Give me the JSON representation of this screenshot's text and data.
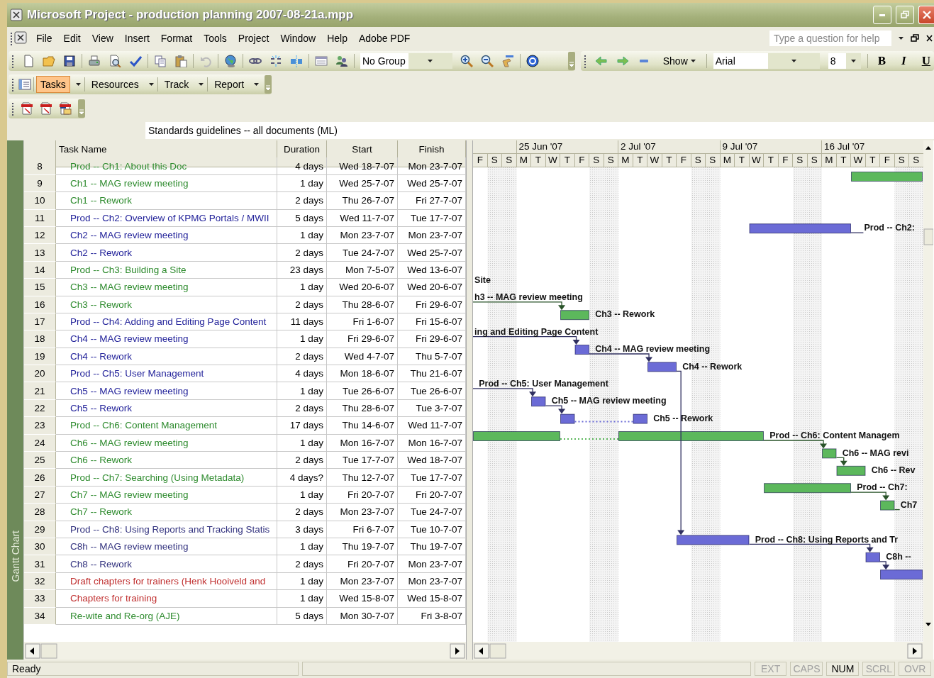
{
  "window": {
    "title": "Microsoft Project - production planning 2007-08-21a.mpp"
  },
  "menu": [
    "File",
    "Edit",
    "View",
    "Insert",
    "Format",
    "Tools",
    "Project",
    "Window",
    "Help",
    "Adobe PDF"
  ],
  "help_box": {
    "placeholder": "Type a question for help"
  },
  "standard_toolbar": {
    "group_combo": "No Group"
  },
  "formatting_toolbar": {
    "show_button": "Show",
    "font_combo": "Arial",
    "size_combo": "8",
    "style_buttons": [
      {
        "label": "B",
        "kind": "bold"
      },
      {
        "label": "I",
        "kind": "italic"
      },
      {
        "label": "U",
        "kind": "underline"
      }
    ]
  },
  "guide_toolbar": {
    "items": [
      {
        "label": "Tasks",
        "selected": true
      },
      {
        "label": "Resources",
        "selected": false
      },
      {
        "label": "Track",
        "selected": false
      },
      {
        "label": "Report",
        "selected": false
      }
    ]
  },
  "entry_bar": {
    "value": "Standards guidelines -- all documents (ML)"
  },
  "view_bar": {
    "label": "Gantt Chart"
  },
  "table": {
    "columns": [
      "Task Name",
      "Duration",
      "Start",
      "Finish"
    ],
    "rows": [
      {
        "id": "8",
        "name": "Prod -- Ch1: About this Doc",
        "duration": "4 days",
        "start": "Wed 18-7-07",
        "finish": "Mon 23-7-07",
        "color": "#2e8b2e"
      },
      {
        "id": "9",
        "name": "Ch1 -- MAG review meeting",
        "duration": "1 day",
        "start": "Wed 25-7-07",
        "finish": "Wed 25-7-07",
        "color": "#2e8b2e"
      },
      {
        "id": "10",
        "name": "Ch1 -- Rework",
        "duration": "2 days",
        "start": "Thu 26-7-07",
        "finish": "Fri 27-7-07",
        "color": "#2e8b2e"
      },
      {
        "id": "11",
        "name": "Prod -- Ch2: Overview of KPMG Portals / MWII",
        "duration": "5 days",
        "start": "Wed 11-7-07",
        "finish": "Tue 17-7-07",
        "color": "#22229a"
      },
      {
        "id": "12",
        "name": "Ch2 -- MAG review meeting",
        "duration": "1 day",
        "start": "Mon 23-7-07",
        "finish": "Mon 23-7-07",
        "color": "#22229a"
      },
      {
        "id": "13",
        "name": "Ch2 -- Rework",
        "duration": "2 days",
        "start": "Tue 24-7-07",
        "finish": "Wed 25-7-07",
        "color": "#22229a"
      },
      {
        "id": "14",
        "name": "Prod -- Ch3: Building a Site",
        "duration": "23 days",
        "start": "Mon 7-5-07",
        "finish": "Wed 13-6-07",
        "color": "#2e8b2e"
      },
      {
        "id": "15",
        "name": "Ch3 -- MAG review meeting",
        "duration": "1 day",
        "start": "Wed 20-6-07",
        "finish": "Wed 20-6-07",
        "color": "#2e8b2e"
      },
      {
        "id": "16",
        "name": "Ch3 -- Rework",
        "duration": "2 days",
        "start": "Thu 28-6-07",
        "finish": "Fri 29-6-07",
        "color": "#2e8b2e"
      },
      {
        "id": "17",
        "name": "Prod -- Ch4: Adding and Editing Page Content",
        "duration": "11 days",
        "start": "Fri 1-6-07",
        "finish": "Fri 15-6-07",
        "color": "#22229a"
      },
      {
        "id": "18",
        "name": "Ch4 -- MAG review meeting",
        "duration": "1 day",
        "start": "Fri 29-6-07",
        "finish": "Fri 29-6-07",
        "color": "#22229a"
      },
      {
        "id": "19",
        "name": "Ch4 -- Rework",
        "duration": "2 days",
        "start": "Wed 4-7-07",
        "finish": "Thu 5-7-07",
        "color": "#22229a"
      },
      {
        "id": "20",
        "name": "Prod -- Ch5: User Management",
        "duration": "4 days",
        "start": "Mon 18-6-07",
        "finish": "Thu 21-6-07",
        "color": "#22229a"
      },
      {
        "id": "21",
        "name": "Ch5 -- MAG review meeting",
        "duration": "1 day",
        "start": "Tue 26-6-07",
        "finish": "Tue 26-6-07",
        "color": "#22229a"
      },
      {
        "id": "22",
        "name": "Ch5 -- Rework",
        "duration": "2 days",
        "start": "Thu 28-6-07",
        "finish": "Tue 3-7-07",
        "color": "#22229a"
      },
      {
        "id": "23",
        "name": "Prod -- Ch6: Content Management",
        "duration": "17 days",
        "start": "Thu 14-6-07",
        "finish": "Wed 11-7-07",
        "color": "#2e8b2e"
      },
      {
        "id": "24",
        "name": "Ch6 -- MAG review meeting",
        "duration": "1 day",
        "start": "Mon 16-7-07",
        "finish": "Mon 16-7-07",
        "color": "#2e8b2e"
      },
      {
        "id": "25",
        "name": "Ch6 -- Rework",
        "duration": "2 days",
        "start": "Tue 17-7-07",
        "finish": "Wed 18-7-07",
        "color": "#2e8b2e"
      },
      {
        "id": "26",
        "name": "Prod -- Ch7: Searching (Using Metadata)",
        "duration": "4 days?",
        "start": "Thu 12-7-07",
        "finish": "Tue 17-7-07",
        "color": "#2e8b2e"
      },
      {
        "id": "27",
        "name": "Ch7 -- MAG review meeting",
        "duration": "1 day",
        "start": "Fri 20-7-07",
        "finish": "Fri 20-7-07",
        "color": "#2e8b2e"
      },
      {
        "id": "28",
        "name": "Ch7 -- Rework",
        "duration": "2 days",
        "start": "Mon 23-7-07",
        "finish": "Tue 24-7-07",
        "color": "#2e8b2e"
      },
      {
        "id": "29",
        "name": "Prod -- Ch8: Using Reports and Tracking Statis",
        "duration": "3 days",
        "start": "Fri 6-7-07",
        "finish": "Tue 10-7-07",
        "color": "#33337f"
      },
      {
        "id": "30",
        "name": "C8h -- MAG review meeting",
        "duration": "1 day",
        "start": "Thu 19-7-07",
        "finish": "Thu 19-7-07",
        "color": "#33337f"
      },
      {
        "id": "31",
        "name": "Ch8 -- Rework",
        "duration": "2 days",
        "start": "Fri 20-7-07",
        "finish": "Mon 23-7-07",
        "color": "#33337f"
      },
      {
        "id": "32",
        "name": "Draft chapters for trainers (Henk Hooiveld and",
        "duration": "1 day",
        "start": "Mon 23-7-07",
        "finish": "Mon 23-7-07",
        "color": "#c03030"
      },
      {
        "id": "33",
        "name": "Chapters for training",
        "duration": "1 day",
        "start": "Wed 15-8-07",
        "finish": "Wed 15-8-07",
        "color": "#c03030"
      },
      {
        "id": "34",
        "name": "Re-wite and Re-org (AJE)",
        "duration": "5 days",
        "start": "Mon 30-7-07",
        "finish": "Fri 3-8-07",
        "color": "#2e8b2e"
      }
    ]
  },
  "gantt": {
    "weeks": [
      "25 Jun '07",
      "2 Jul '07",
      "9 Jul '07",
      "16 Jul '07"
    ],
    "days": [
      {
        "label": "F",
        "weekend": false
      },
      {
        "label": "S",
        "weekend": true
      },
      {
        "label": "S",
        "weekend": true
      },
      {
        "label": "M",
        "weekend": false
      },
      {
        "label": "T",
        "weekend": false
      },
      {
        "label": "W",
        "weekend": false
      },
      {
        "label": "T",
        "weekend": false
      },
      {
        "label": "F",
        "weekend": false
      },
      {
        "label": "S",
        "weekend": true
      },
      {
        "label": "S",
        "weekend": true
      },
      {
        "label": "M",
        "weekend": false
      },
      {
        "label": "T",
        "weekend": false
      },
      {
        "label": "W",
        "weekend": false
      },
      {
        "label": "T",
        "weekend": false
      },
      {
        "label": "F",
        "weekend": false
      },
      {
        "label": "S",
        "weekend": true
      },
      {
        "label": "S",
        "weekend": true
      },
      {
        "label": "M",
        "weekend": false
      },
      {
        "label": "T",
        "weekend": false
      },
      {
        "label": "W",
        "weekend": false
      },
      {
        "label": "T",
        "weekend": false
      },
      {
        "label": "F",
        "weekend": false
      },
      {
        "label": "S",
        "weekend": true
      },
      {
        "label": "S",
        "weekend": true
      },
      {
        "label": "M",
        "weekend": false
      },
      {
        "label": "T",
        "weekend": false
      },
      {
        "label": "W",
        "weekend": false
      },
      {
        "label": "T",
        "weekend": false
      },
      {
        "label": "F",
        "weekend": false
      },
      {
        "label": "S",
        "weekend": true
      },
      {
        "label": "S",
        "weekend": true
      }
    ],
    "bars": [
      {
        "color": "#5cb85c"
      },
      {
        "label": "Prod -- Ch2:",
        "color": "#6b6bd6"
      },
      {
        "label": "Site"
      },
      {
        "label": "h3 -- MAG review meeting"
      },
      {
        "label": "Ch3 -- Rework",
        "color": "#5cb85c"
      },
      {
        "label": "ing and Editing Page Content"
      },
      {
        "label": "Ch4 -- MAG review meeting",
        "color": "#6b6bd6"
      },
      {
        "label": "Ch4 -- Rework",
        "color": "#6b6bd6"
      },
      {
        "label": "Prod -- Ch5: User Management"
      },
      {
        "label": "Ch5 -- MAG review meeting",
        "color": "#6b6bd6"
      },
      {
        "label": "Ch5 -- Rework",
        "color": "#6b6bd6"
      },
      {
        "label": "Prod -- Ch6: Content Managem",
        "color": "#5cb85c"
      },
      {
        "label": "Ch6 -- MAG revi",
        "color": "#5cb85c"
      },
      {
        "label": "Ch6 -- Rev",
        "color": "#5cb85c"
      },
      {
        "label": "Prod -- Ch7:",
        "color": "#5cb85c"
      },
      {
        "label": "Ch7",
        "color": "#5cb85c"
      },
      {
        "label": "Prod -- Ch8: Using Reports and Tr",
        "color": "#6b6bd6"
      },
      {
        "label": "C8h --",
        "color": "#6b6bd6"
      },
      {
        "color": "#6b6bd6"
      }
    ]
  },
  "status_bar": {
    "text": "Ready",
    "indicators": [
      {
        "label": "EXT",
        "on": false
      },
      {
        "label": "CAPS",
        "on": false
      },
      {
        "label": "NUM",
        "on": true
      },
      {
        "label": "SCRL",
        "on": false
      },
      {
        "label": "OVR",
        "on": false
      }
    ]
  }
}
